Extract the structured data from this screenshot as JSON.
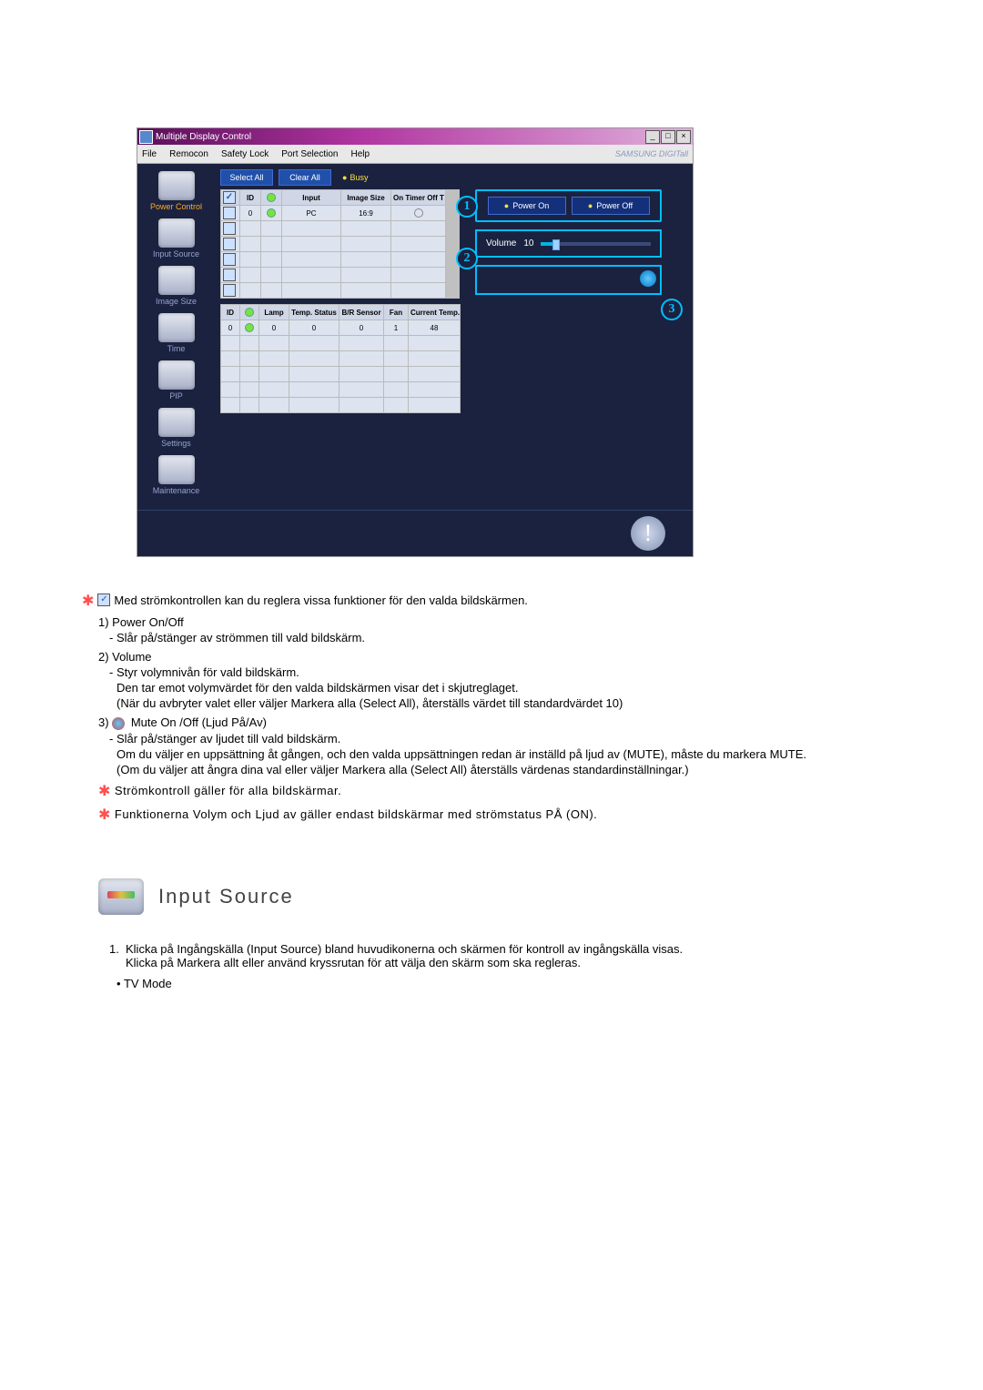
{
  "app": {
    "title": "Multiple Display Control",
    "menu": [
      "File",
      "Remocon",
      "Safety Lock",
      "Port Selection",
      "Help"
    ],
    "brand": "SAMSUNG DIGITall"
  },
  "sidebar": {
    "items": [
      {
        "label": "Power Control"
      },
      {
        "label": "Input Source"
      },
      {
        "label": "Image Size"
      },
      {
        "label": "Time"
      },
      {
        "label": "PIP"
      },
      {
        "label": "Settings"
      },
      {
        "label": "Maintenance"
      }
    ]
  },
  "toolbar": {
    "select_all": "Select All",
    "clear_all": "Clear All",
    "busy": "Busy"
  },
  "table1": {
    "headers": [
      "",
      "ID",
      "",
      "Input",
      "Image Size",
      "On Timer Off T"
    ],
    "row": {
      "id": "0",
      "input": "PC",
      "image_size": "16:9"
    }
  },
  "table2": {
    "headers": [
      "ID",
      "",
      "Lamp",
      "Temp. Status",
      "B/R Sensor",
      "Fan",
      "Current Temp."
    ],
    "row": {
      "id": "0",
      "lamp": "0",
      "temp_status": "0",
      "br_sensor": "0",
      "fan": "1",
      "current_temp": "48"
    }
  },
  "panel": {
    "power_on": "Power On",
    "power_off": "Power Off",
    "volume_label": "Volume",
    "volume_value": "10"
  },
  "callouts": {
    "c1": "1",
    "c2": "2",
    "c3": "3"
  },
  "body": {
    "intro": "Med strömkontrollen kan du reglera vissa funktioner för den valda bildskärmen.",
    "i1_label": "1)  Power On/Off",
    "i1_sub": "- Slår på/stänger av strömmen till vald bildskärm.",
    "i2_label": "2)  Volume",
    "i2_sub1": "- Styr volymnivån för vald bildskärm.",
    "i2_sub2": "Den tar emot volymvärdet för den valda bildskärmen visar det i skjutreglaget.",
    "i2_sub3": "(När du avbryter valet eller väljer Markera alla (Select All), återställs värdet till standardvärdet 10)",
    "i3_label": "3)",
    "i3_title": "Mute On /Off (Ljud På/Av)",
    "i3_sub1": "- Slår på/stänger av ljudet till vald bildskärm.",
    "i3_sub2": "Om du väljer en uppsättning åt gången, och den valda uppsättningen redan är inställd på ljud av (MUTE), måste du markera MUTE.",
    "i3_sub3": "(Om du väljer att ångra dina val eller väljer Markera alla (Select All) återställs värdenas standardinställningar.)",
    "note1": "Strömkontroll gäller för alla bildskärmar.",
    "note2": "Funktionerna Volym och Ljud av gäller endast bildskärmar med strömstatus PÅ (ON).",
    "section_title": "Input Source",
    "is_1": "Klicka på Ingångskälla (Input Source) bland huvudikonerna och skärmen för kontroll av ingångskälla visas.",
    "is_1b": "Klicka på Markera allt eller använd kryssrutan för att välja den skärm som ska regleras.",
    "is_bullet": "TV Mode"
  }
}
